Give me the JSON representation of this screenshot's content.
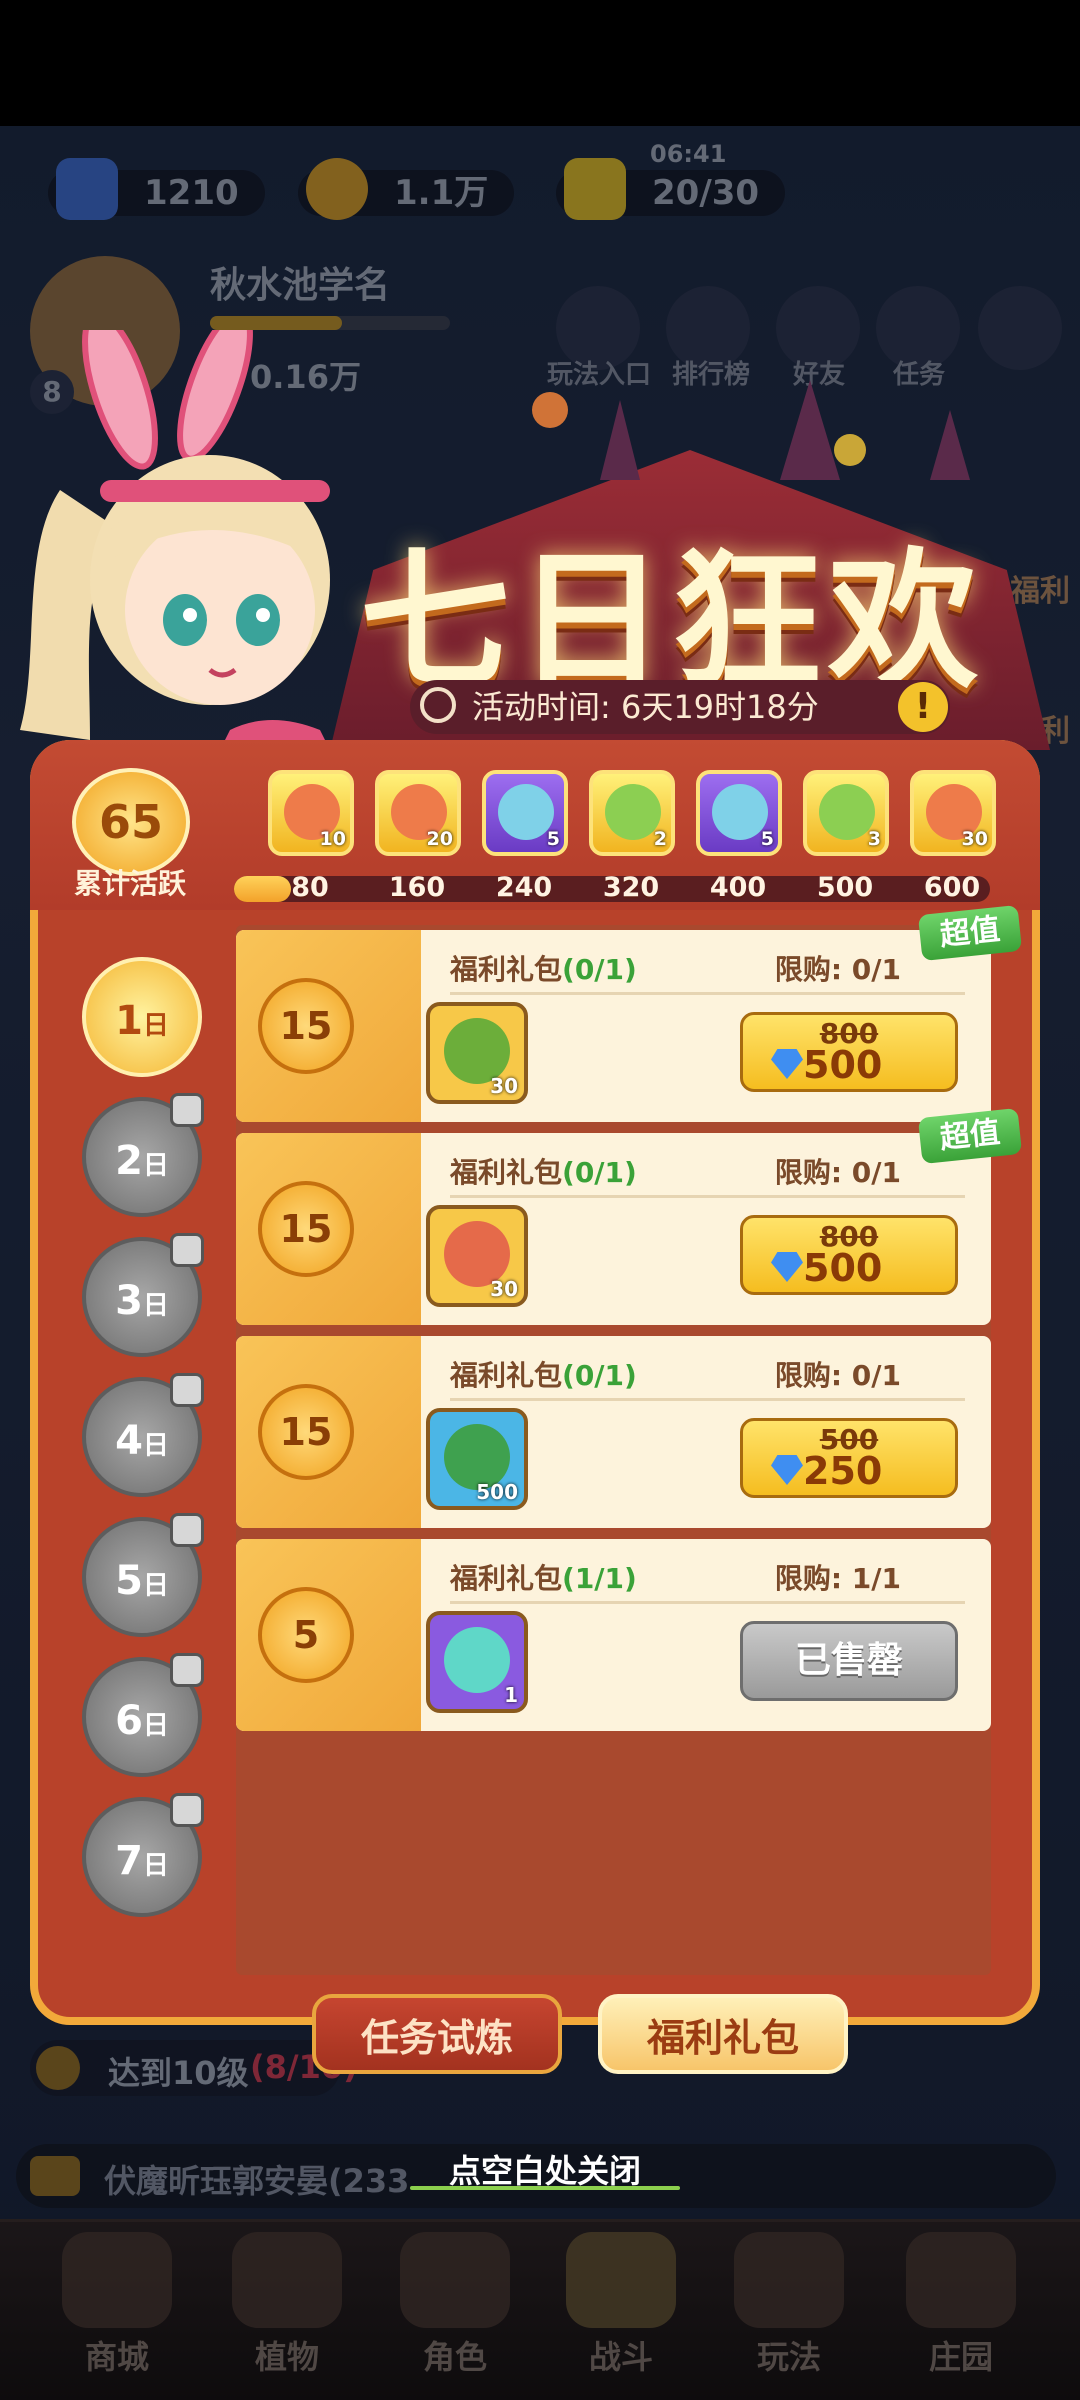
{
  "topbar": {
    "gems": "1210",
    "coins": "1.1万",
    "energy": "20/30",
    "energy_timer": "06:41"
  },
  "player": {
    "name": "秋水池学名",
    "level": "8",
    "power": "0.16万"
  },
  "shortcuts": [
    "玩法入口",
    "排行榜",
    "好友",
    "任务"
  ],
  "side_labels": {
    "welfare": "福利",
    "welfare2": "福利"
  },
  "quest": {
    "text": "达到10级",
    "progress": "(8/10)"
  },
  "chat": {
    "text": "伏魔昕珏郭安晏(233"
  },
  "nav": [
    "商城",
    "植物",
    "角色",
    "战斗",
    "玩法",
    "庄园"
  ],
  "event": {
    "title": "七日狂欢",
    "time_label": "活动时间: 6天19时18分"
  },
  "activity": {
    "points": "65",
    "label": "累计活跃",
    "progress_fraction": 0.075,
    "milestones": [
      "80",
      "160",
      "240",
      "320",
      "400",
      "500",
      "600"
    ],
    "rewards": [
      {
        "count": "10",
        "type": "gold",
        "icon": "fox-icon"
      },
      {
        "count": "20",
        "type": "gold",
        "icon": "fox-icon"
      },
      {
        "count": "5",
        "type": "purple",
        "icon": "leaf-icon"
      },
      {
        "count": "2",
        "type": "gold",
        "icon": "leaf-icon"
      },
      {
        "count": "5",
        "type": "purple",
        "icon": "leaf-icon"
      },
      {
        "count": "3",
        "type": "gold",
        "icon": "leaf-icon"
      },
      {
        "count": "30",
        "type": "gold",
        "icon": "fox-icon"
      }
    ]
  },
  "days": [
    {
      "num": "1",
      "unit": "日",
      "active": true
    },
    {
      "num": "2",
      "unit": "日",
      "active": false
    },
    {
      "num": "3",
      "unit": "日",
      "active": false
    },
    {
      "num": "4",
      "unit": "日",
      "active": false
    },
    {
      "num": "5",
      "unit": "日",
      "active": false
    },
    {
      "num": "6",
      "unit": "日",
      "active": false
    },
    {
      "num": "7",
      "unit": "日",
      "active": false
    }
  ],
  "packs": [
    {
      "points": "15",
      "title": "福利礼包",
      "count_text": "(0/1)",
      "limit": "限购: 0/1",
      "item_count": "30",
      "old_price": "800",
      "price": "500",
      "badge": "超值",
      "sold": false,
      "item_bg": "#f7c848",
      "item_art": "#6cae3a"
    },
    {
      "points": "15",
      "title": "福利礼包",
      "count_text": "(0/1)",
      "limit": "限购: 0/1",
      "item_count": "30",
      "old_price": "800",
      "price": "500",
      "badge": "超值",
      "sold": false,
      "item_bg": "#f7c848",
      "item_art": "#e56a4a"
    },
    {
      "points": "15",
      "title": "福利礼包",
      "count_text": "(0/1)",
      "limit": "限购: 0/1",
      "item_count": "500",
      "old_price": "500",
      "price": "250",
      "badge": "",
      "sold": false,
      "item_bg": "#4bb6e6",
      "item_art": "#3fa14f"
    },
    {
      "points": "5",
      "title": "福利礼包",
      "count_text": "(1/1)",
      "limit": "限购: 1/1",
      "item_count": "1",
      "old_price": "",
      "price": "",
      "badge": "",
      "sold": true,
      "sold_label": "已售罄",
      "item_bg": "#8a5ae0",
      "item_art": "#5fd7c8"
    }
  ],
  "tabs": {
    "task": "任务试炼",
    "pack": "福利礼包"
  },
  "close_hint": "点空白处关闭"
}
